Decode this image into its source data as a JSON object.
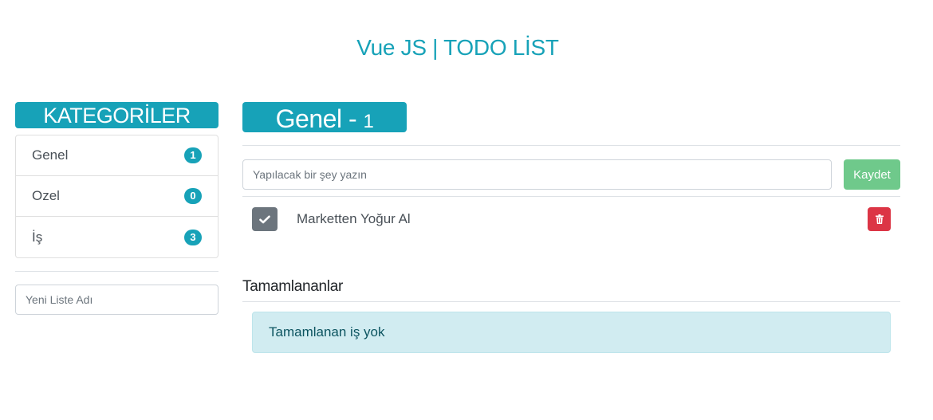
{
  "header": {
    "title": "Vue JS | TODO LİST"
  },
  "sidebar": {
    "title": "KATEGORİLER",
    "items": [
      {
        "label": "Genel",
        "count": "1"
      },
      {
        "label": "Ozel",
        "count": "0"
      },
      {
        "label": "İş",
        "count": "3"
      }
    ],
    "new_list_placeholder": "Yeni Liste Adı"
  },
  "main": {
    "list_title": "Genel - ",
    "list_count": "1",
    "todo_placeholder": "Yapılacak bir şey yazın",
    "save_label": "Kaydet",
    "todos": [
      {
        "text": "Marketten Yoğur Al"
      }
    ],
    "completed_title": "Tamamlananlar",
    "completed_empty": "Tamamlanan iş yok"
  },
  "colors": {
    "primary": "#17a2b8",
    "save": "#6fc98b",
    "delete": "#dc3545",
    "check": "#6c757d",
    "alert_bg": "#d1ecf1"
  },
  "icons": {
    "check": "check-icon",
    "delete": "trash-icon"
  }
}
